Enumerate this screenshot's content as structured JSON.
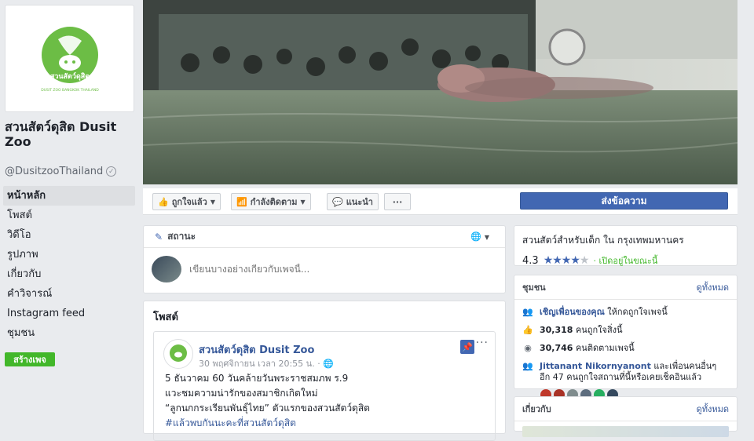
{
  "page": {
    "name": "สวนสัตว์ดุสิต Dusit Zoo",
    "handle": "@DusitzooThailand"
  },
  "logo": {
    "thai": "สวนสัตว์ดุสิต",
    "english": "DUSIT ZOO BANGKOK THAILAND",
    "color": "#6cbd45"
  },
  "left_nav": [
    {
      "label": "หน้าหลัก",
      "active": true
    },
    {
      "label": "โพสต์"
    },
    {
      "label": "วิดีโอ"
    },
    {
      "label": "รูปภาพ"
    },
    {
      "label": "เกี่ยวกับ"
    },
    {
      "label": "คำวิจารณ์"
    },
    {
      "label": "Instagram feed"
    },
    {
      "label": "ชุมชน"
    }
  ],
  "create_page_label": "สร้างเพจ",
  "action_bar": {
    "liked": "ถูกใจแล้ว",
    "following": "กำลังติดตาม",
    "recommend": "แนะนำ",
    "more": "···",
    "send_message": "ส่งข้อความ"
  },
  "composer": {
    "tab": "สถานะ",
    "placeholder": "เขียนบางอย่างเกี่ยวกับเพจนี้..."
  },
  "posts": {
    "title": "โพสต์",
    "post": {
      "author": "สวนสัตว์ดุสิต Dusit Zoo",
      "time": "30 พฤศจิกายน เวลา 20:55 น. ·",
      "line1": "5 ธันวาคม 60 วันคล้ายวันพระราชสมภพ ร.9",
      "line2": "แวะชมความน่ารักของสมาชิกเกิดใหม่",
      "line3": "“ลูกนกกระเรียนพันธุ์ไทย” ตัวแรกของสวนสัตว์ดุสิต",
      "hashtag": "#แล้วพบกันนะคะที่สวนสัตว์ดุสิต"
    }
  },
  "rating": {
    "title": "สวนสัตว์สำหรับเด็ก ใน กรุงเทพมหานคร",
    "score": "4.3",
    "stars": "★★★★",
    "star_off": "★",
    "open": "· เปิดอยู่ในขณะนี้"
  },
  "community": {
    "title": "ชุมชน",
    "see_all": "ดูทั้งหมด",
    "invite_link": "เชิญเพื่อนของคุณ",
    "invite_rest": " ให้กดถูกใจเพจนี้",
    "likes": "30,318",
    "likes_text": " คนถูกใจสิ่งนี้",
    "follows": "30,746",
    "follows_text": " คนติดตามเพจนี้",
    "friend_name": "Jittanant Nikornyanont",
    "friend_rest": " และเพื่อนคนอื่นๆ อีก 47 คนถูกใจสถานที่นี้หรือเคยเช็คอินแล้ว"
  },
  "about": {
    "title": "เกี่ยวกับ",
    "see_all": "ดูทั้งหมด"
  }
}
